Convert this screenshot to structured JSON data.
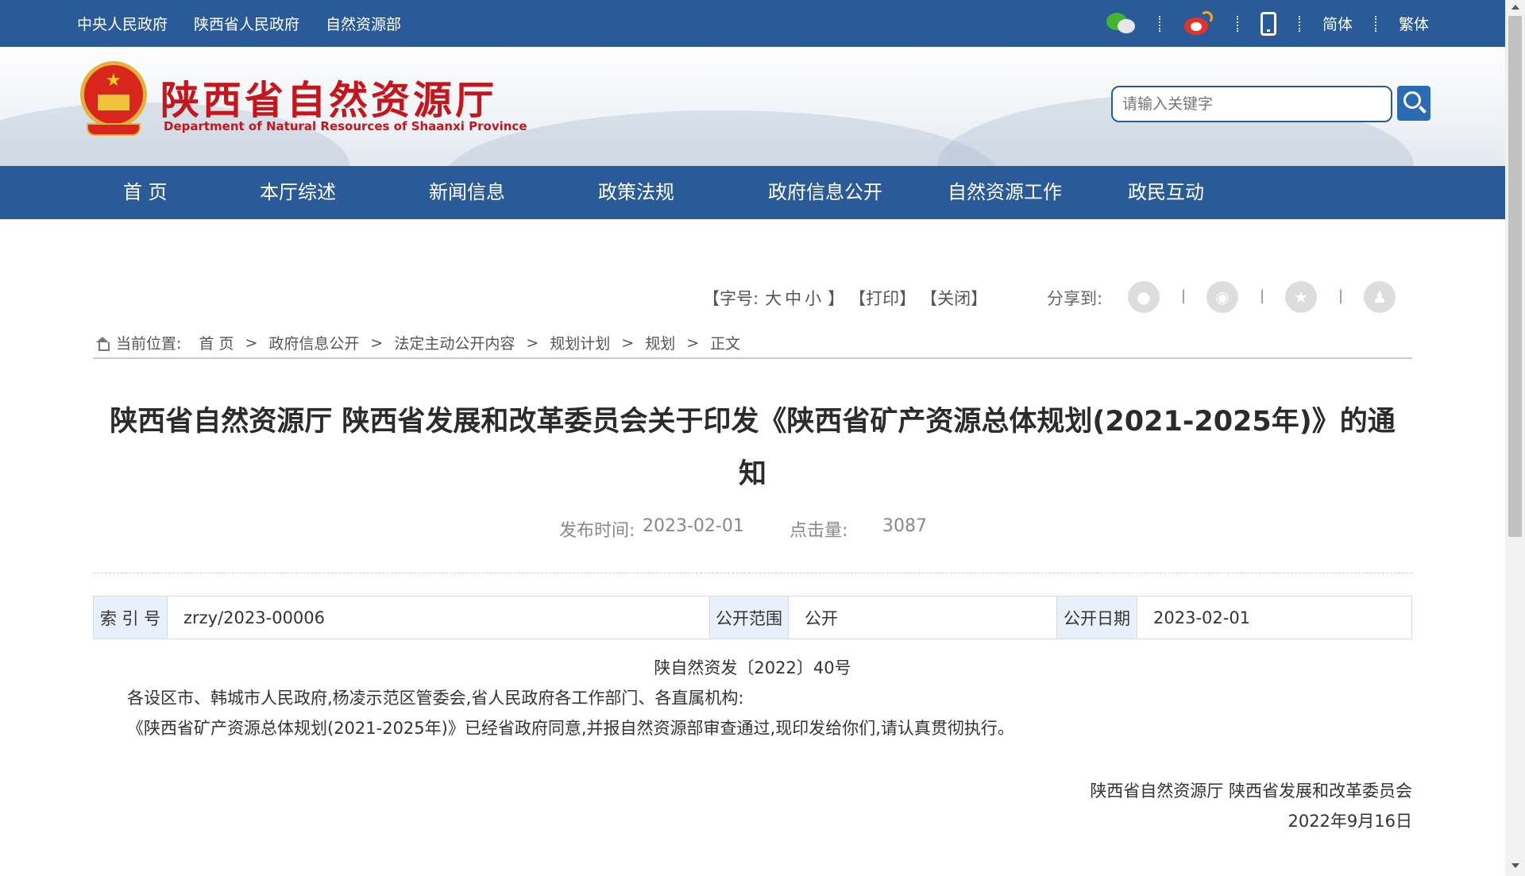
{
  "topbar": {
    "links": [
      "中央人民政府",
      "陕西省人民政府",
      "自然资源部"
    ],
    "lang_simplified": "简体",
    "lang_traditional": "繁体"
  },
  "header": {
    "title": "陕西省自然资源厅",
    "subtitle": "Department of Natural Resources of Shaanxi Province",
    "search_placeholder": "请输入关键字"
  },
  "nav": [
    "首 页",
    "本厅综述",
    "新闻信息",
    "政策法规",
    "政府信息公开",
    "自然资源工作",
    "政民互动"
  ],
  "tools": {
    "font_open": "【字号:",
    "large": "大",
    "medium": "中",
    "small": "小",
    "font_close": "】",
    "print": "【打印】",
    "close": "【关闭】",
    "share_label": "分享到:"
  },
  "breadcrumb": {
    "label": "当前位置:",
    "items": [
      "首 页",
      "政府信息公开",
      "法定主动公开内容",
      "规划计划",
      "规划",
      "正文"
    ],
    "separator": ">"
  },
  "article": {
    "title_line1": "陕西省自然资源厅  陕西省发展和改革委员会关于印发《陕西省矿产资源总体规划(2021-2025年)》的通",
    "title_line2": "知",
    "publish_label": "发布时间:",
    "publish_date": "2023-02-01",
    "hits_label": "点击量:",
    "hits": "3087"
  },
  "info": {
    "index_label": "索 引 号",
    "index_value": "zrzy/2023-00006",
    "scope_label": "公开范围",
    "scope_value": "公开",
    "date_label": "公开日期",
    "date_value": "2023-02-01"
  },
  "body": {
    "doc_number": "陕自然资发〔2022〕40号",
    "addressee": "各设区市、韩城市人民政府,杨凌示范区管委会,省人民政府各工作部门、各直属机构:",
    "paragraph": "《陕西省矿产资源总体规划(2021-2025年)》已经省政府同意,并报自然资源部审查通过,现印发给你们,请认真贯彻执行。",
    "signature": "陕西省自然资源厅 陕西省发展和改革委员会",
    "sign_date": "2022年9月16日"
  }
}
